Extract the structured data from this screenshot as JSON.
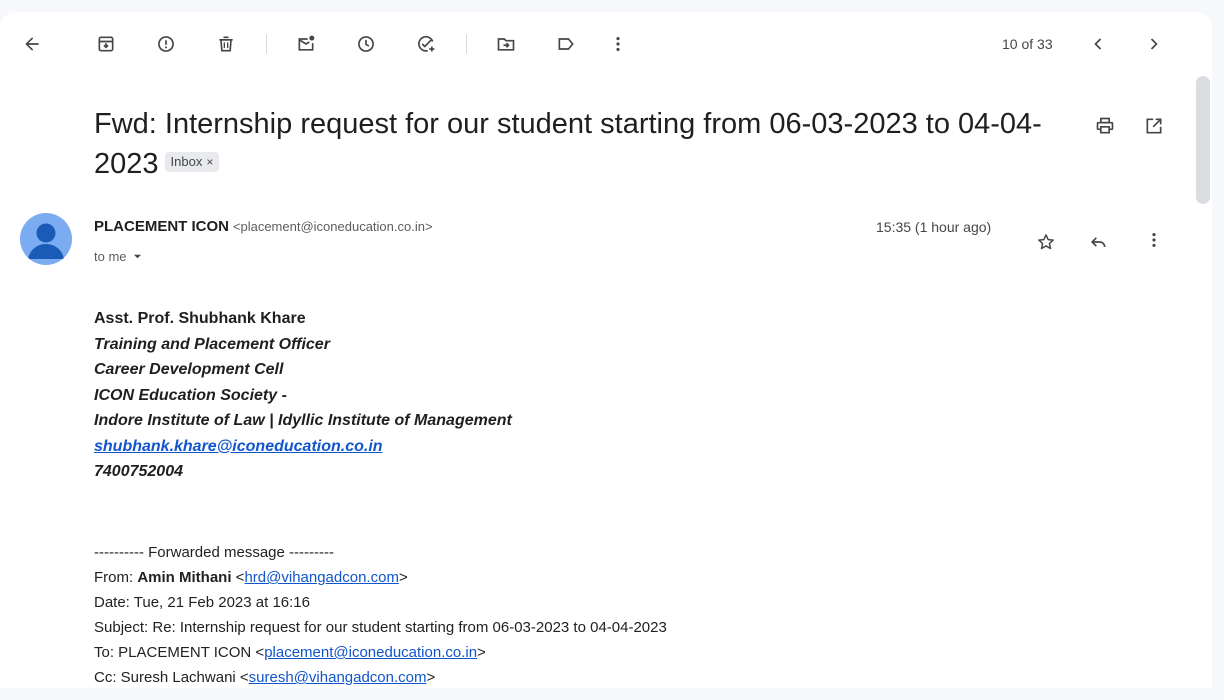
{
  "toolbar": {
    "pager": "10 of 33",
    "icons": [
      "back-arrow-icon",
      "archive-icon",
      "report-spam-icon",
      "delete-icon",
      "mark-unread-icon",
      "snooze-icon",
      "add-task-icon",
      "move-to-icon",
      "label-icon",
      "more-vertical-icon",
      "chevron-left-icon",
      "chevron-right-icon"
    ]
  },
  "subject": {
    "text": "Fwd: Internship request for our student starting from 06-03-2023 to 04-04-2023",
    "label": "Inbox",
    "label_close": "×"
  },
  "message": {
    "sender_name": "PLACEMENT ICON",
    "sender_email": "<placement@iconeducation.co.in>",
    "recipient": "to me",
    "time": "15:35 (1 hour ago)"
  },
  "signature": {
    "name": "Asst. Prof. Shubhank Khare",
    "title": "Training and Placement Officer",
    "dept": "Career Development Cell",
    "org": "ICON Education Society -",
    "institutes": "Indore Institute of Law | Idyllic Institute of Management",
    "email": "shubhank.khare@iconeducation.co.in",
    "phone": "7400752004"
  },
  "forwarded": {
    "header": "---------- Forwarded message ---------",
    "from_label": "From: ",
    "from_name": "Amin Mithani",
    "from_email": "hrd@vihangadcon.com",
    "date": "Date: Tue, 21 Feb 2023 at 16:16",
    "subject": "Subject: Re: Internship request for our student starting from 06-03-2023 to 04-04-2023",
    "to_label": "To: PLACEMENT ICON <",
    "to_email": "placement@iconeducation.co.in",
    "cc_label": "Cc: Suresh Lachwani <",
    "cc_email": "suresh@vihangadcon.com"
  },
  "colors": {
    "link": "#1155cc",
    "avatar": "#7babf0",
    "background": "#f6f8fc"
  }
}
